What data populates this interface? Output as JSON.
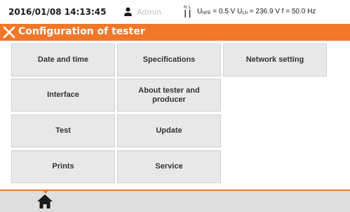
{
  "status": {
    "datetime": "2016/01/08 14:13:45",
    "user": "Admin",
    "measure": {
      "unpe_label": "U",
      "unpe_sub": "NPE",
      "unpe_value": " = 0.5 V ",
      "uln_label": "U",
      "uln_sub": "LN",
      "uln_value": " = 236.9 V ",
      "freq": "f = 50.0 Hz"
    },
    "icons": [
      "user-icon",
      "phase-nl-icon"
    ]
  },
  "titlebar": {
    "title": "Configuration of tester",
    "icon": "tools-icon",
    "color": "#f07828"
  },
  "menu": {
    "date_time": "Date and time",
    "specifications": "Specifications",
    "network_setting": "Network setting",
    "interface": "Interface",
    "about": "About tester and producer",
    "test": "Test",
    "update": "Update",
    "prints": "Prints",
    "service": "Service"
  },
  "bottom": {
    "home_icon": "home-icon"
  }
}
